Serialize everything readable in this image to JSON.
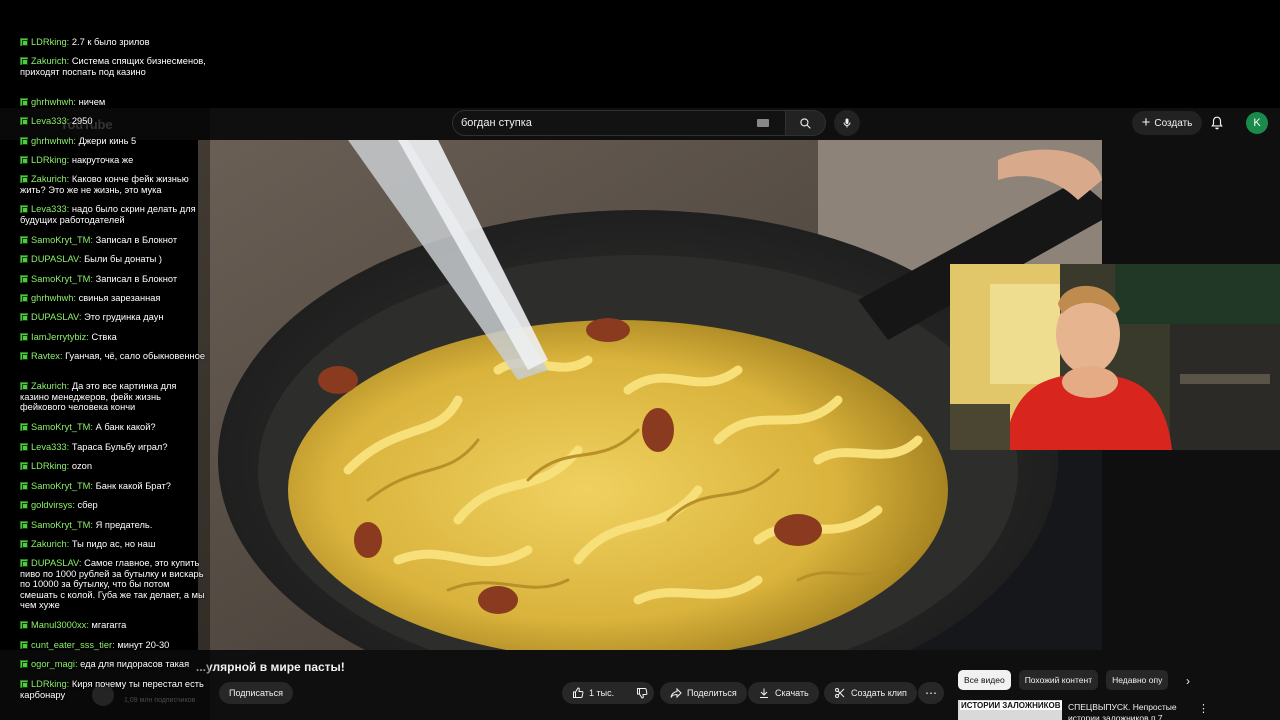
{
  "youtube": {
    "logo": "YouTube",
    "search": {
      "value": "богдан ступка"
    },
    "create_label": "Создать",
    "avatar_letter": "K",
    "video": {
      "title": "...улярной в мире пасты!",
      "channel_subs": "1,09 млн подписчиков",
      "subscribe_label": "Подписаться"
    },
    "actions": {
      "likes": "1 тыс.",
      "share": "Поделиться",
      "download": "Скачать",
      "clip": "Создать клип"
    },
    "chips": [
      "Все видео",
      "Похожий контент",
      "Недавно опу"
    ],
    "recommendation": {
      "thumb_text": "ИСТОРИИ ЗАЛОЖНИКОВ",
      "title": "СПЕЦВЫПУСК. Непростые истории заложников п.7"
    }
  },
  "chat": [
    {
      "user": "LDRking",
      "text": "2.7 к было зрилов"
    },
    {
      "user": "Zakurich",
      "text": "Система спящих бизнесменов, приходят поспать под казино"
    },
    {
      "user": "ghrhwhwh",
      "text": "ничем"
    },
    {
      "user": "Leva333",
      "text": "2950"
    },
    {
      "user": "ghrhwhwh",
      "text": "Джери кинь 5"
    },
    {
      "user": "LDRking",
      "text": "накруточка же"
    },
    {
      "user": "Zakurich",
      "text": "Каково конче фейк жизнью жить? Это же не жизнь, это мука"
    },
    {
      "user": "Leva333",
      "text": "надо было скрин делать для будущих работодателей"
    },
    {
      "user": "SamoKryt_TM",
      "text": "Записал в Блокнот"
    },
    {
      "user": "DUPASLAV",
      "text": "Были бы донаты )"
    },
    {
      "user": "SamoKryt_TM",
      "text": "Записал в Блокнот"
    },
    {
      "user": "ghrhwhwh",
      "text": "свинья зарезанная"
    },
    {
      "user": "DUPASLAV",
      "text": "Это грудинка даун"
    },
    {
      "user": "IamJerrytybiz",
      "text": "Ствка"
    },
    {
      "user": "Ravtex",
      "text": "Гуанчая, чё, сало обыкновенное"
    },
    {
      "user": "Zakurich",
      "text": "Да это все картинка для казино менеджеров, фейк жизнь фейкового человека кончи"
    },
    {
      "user": "SamoKryt_TM",
      "text": "А банк какой?"
    },
    {
      "user": "Leva333",
      "text": "Тараса Бульбу играл?"
    },
    {
      "user": "LDRking",
      "text": "ozon"
    },
    {
      "user": "SamoKryt_TM",
      "text": "Банк какой Брат?"
    },
    {
      "user": "goldvirsys",
      "text": "сбер"
    },
    {
      "user": "SamoKryt_TM",
      "text": "Я предатель."
    },
    {
      "user": "Zakurich",
      "text": "Ты пидо ас, но наш"
    },
    {
      "user": "DUPASLAV",
      "text": "Самое главное, это купить пиво по 1000 рублей за бутылку и вискарь по 10000 за бутылку, что бы потом смешать с колой. Губа же так делает, а мы чем хуже"
    },
    {
      "user": "Manul3000xx",
      "text": "мгагагга"
    },
    {
      "user": "cunt_eater_sss_tier",
      "text": "минут 20-30"
    },
    {
      "user": "ogor_magi",
      "text": "еда для пидорасов такая"
    },
    {
      "user": "LDRking",
      "text": "Киря почему ты перестал есть карбонару"
    }
  ]
}
